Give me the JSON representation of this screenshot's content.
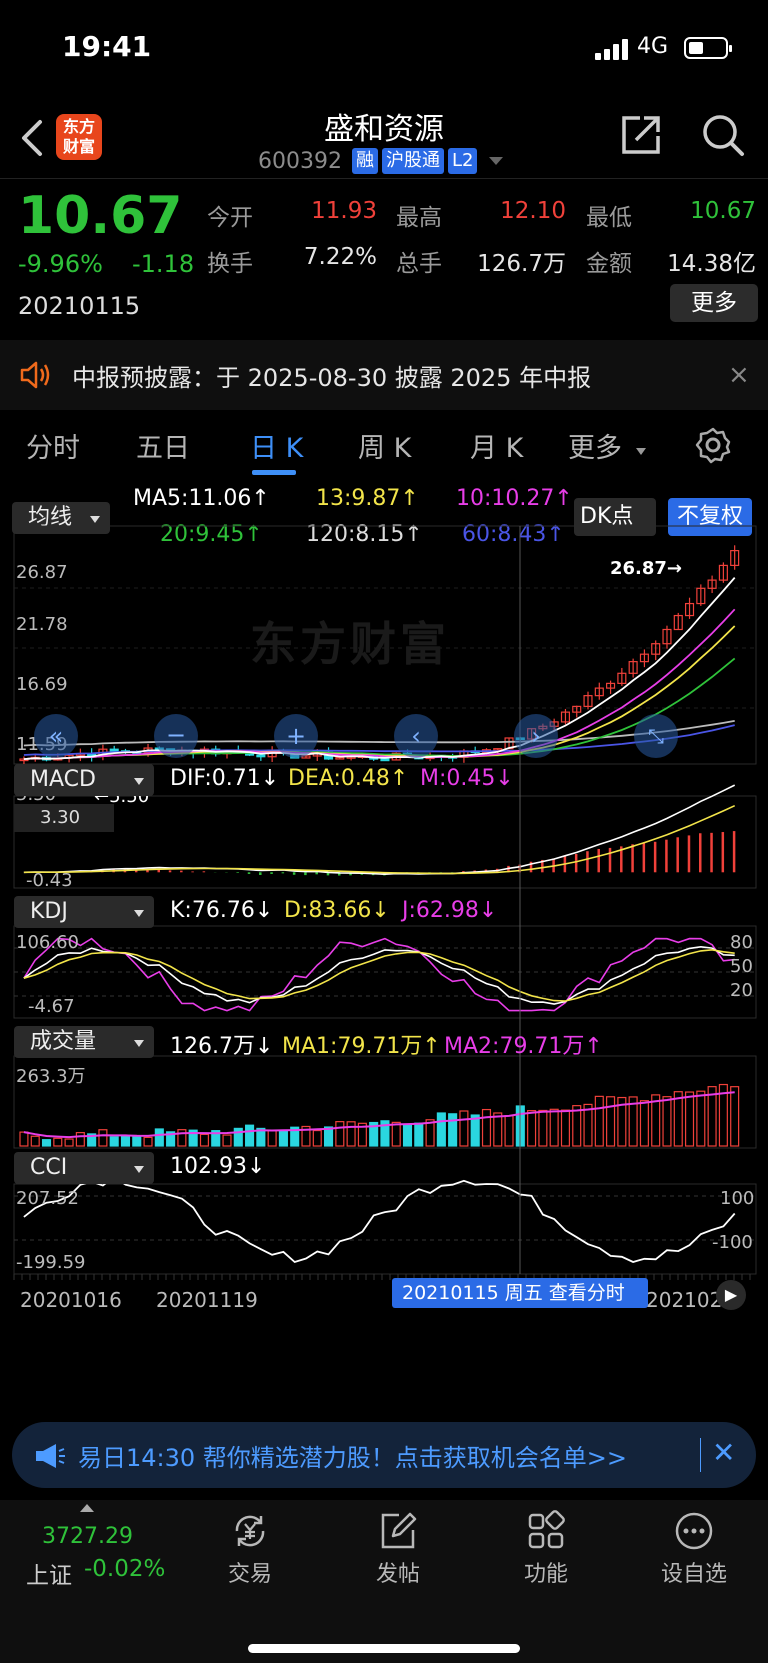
{
  "status": {
    "time": "19:41",
    "network": "4G"
  },
  "header": {
    "logo_text": "东方财富",
    "stock_name": "盛和资源",
    "stock_code": "600392",
    "tags": [
      "融",
      "沪股通",
      "L2"
    ]
  },
  "quote": {
    "price": "10.67",
    "change_pct": "-9.96%",
    "change": "-1.18",
    "date": "20210115",
    "fields": [
      {
        "label": "今开",
        "value": "11.93",
        "color": "#f0413a"
      },
      {
        "label": "最高",
        "value": "12.10",
        "color": "#f0413a"
      },
      {
        "label": "最低",
        "value": "10.67",
        "color": "#2fc23a"
      },
      {
        "label": "换手",
        "value": "7.22%",
        "color": "#e6e6e6"
      },
      {
        "label": "总手",
        "value": "126.7万",
        "color": "#e6e6e6"
      },
      {
        "label": "金额",
        "value": "14.38亿",
        "color": "#e6e6e6"
      }
    ],
    "more_label": "更多"
  },
  "notice": {
    "text": "中报预披露：于 2025-08-30 披露 2025 年中报"
  },
  "tabs": [
    {
      "label": "分时",
      "active": false
    },
    {
      "label": "五日",
      "active": false
    },
    {
      "label": "日 K",
      "active": true
    },
    {
      "label": "周 K",
      "active": false
    },
    {
      "label": "月 K",
      "active": false
    },
    {
      "label": "更多",
      "active": false
    }
  ],
  "main_chart": {
    "selector_label": "均线",
    "ma": {
      "ma5": "MA5:11.06↑",
      "ma13": "13:9.87↑",
      "ma10": "10:10.27↑",
      "ma20": "20:9.45↑",
      "ma120": "120:8.15↑",
      "ma60": "60:8.43↑"
    },
    "dk_button": "DK点",
    "fq_button": "不复权",
    "y_ticks": [
      "26.87",
      "21.78",
      "16.69",
      "11.59",
      "5.50"
    ],
    "max_marker": "26.87→",
    "min_marker": "←5.50",
    "watermark": "东方财富"
  },
  "macd": {
    "selector_label": "MACD",
    "dif": "DIF:0.71↓",
    "dea": "DEA:0.48↑",
    "m": "M:0.45↓",
    "y_top": "3.30",
    "y_bottom": "-0.43"
  },
  "kdj": {
    "selector_label": "KDJ",
    "k": "K:76.76↓",
    "d": "D:83.66↓",
    "j": "J:62.98↓",
    "y_top": "106.60",
    "y_bottom": "-4.67",
    "right_ticks": [
      "80",
      "50",
      "20"
    ]
  },
  "volume": {
    "selector_label": "成交量",
    "vol": "126.7万↓",
    "ma1": "MA1:79.71万↑",
    "ma2": "MA2:79.71万↑",
    "y_top": "263.3万"
  },
  "cci": {
    "selector_label": "CCI",
    "value": "102.93↓",
    "y_top": "207.52",
    "y_bottom": "-199.59",
    "right_ticks": [
      "100",
      "-100"
    ]
  },
  "x_axis": {
    "labels": [
      "20201016",
      "20201119",
      "2021020"
    ],
    "crosshair_label": "20210115 周五 查看分时"
  },
  "colors": {
    "up": "#f0413a",
    "down": "#2fc23a",
    "cyan": "#2ad6e0",
    "accent": "#3e8ff7",
    "ma5": "#ffffff",
    "ma10": "#e83ee8",
    "ma13": "#f2e44a",
    "ma20": "#2fc23a",
    "ma60": "#4a55e6",
    "ma120": "#bbbbbb"
  },
  "ad": {
    "text": "易日14:30 帮你精选潜力股！点击获取机会名单>>"
  },
  "bottom_nav": {
    "index_value": "3727.29",
    "index_name": "上证",
    "index_change": "-0.02%",
    "items": [
      {
        "label": "交易",
        "icon": "yen-exchange-icon"
      },
      {
        "label": "发帖",
        "icon": "edit-post-icon"
      },
      {
        "label": "功能",
        "icon": "grid-apps-icon"
      },
      {
        "label": "设自选",
        "icon": "more-dots-icon"
      }
    ]
  }
}
